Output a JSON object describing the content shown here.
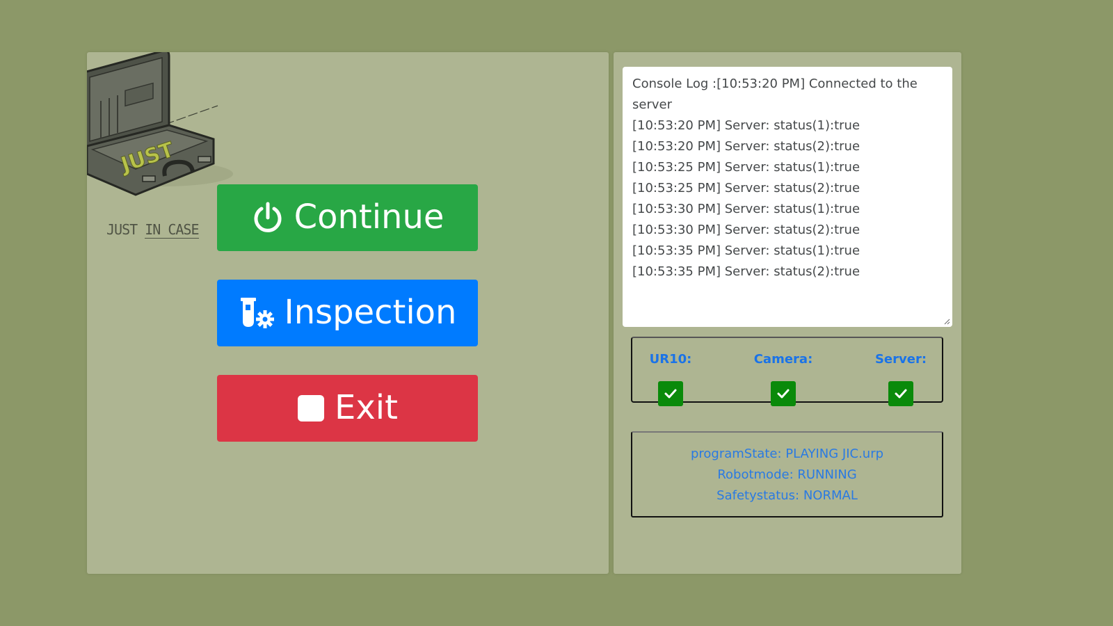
{
  "logo": {
    "caption_part1": "JUST ",
    "caption_part2": "IN CASE",
    "case_word": "JUST"
  },
  "buttons": {
    "continue": {
      "label": "Continue",
      "icon": "power-icon",
      "color": "#28a745"
    },
    "inspection": {
      "label": "Inspection",
      "icon": "flask-gear-icon",
      "color": "#007bff"
    },
    "exit": {
      "label": "Exit",
      "icon": "stop-icon",
      "color": "#dc3545"
    }
  },
  "console": {
    "lines": [
      "Console Log :[10:53:20 PM] Connected to the server",
      "[10:53:20 PM] Server: status(1):true",
      "[10:53:20 PM] Server: status(2):true",
      "[10:53:25 PM] Server: status(1):true",
      "[10:53:25 PM] Server: status(2):true",
      "[10:53:30 PM] Server: status(1):true",
      "[10:53:30 PM] Server: status(2):true",
      "[10:53:35 PM] Server: status(1):true",
      "[10:53:35 PM] Server: status(2):true"
    ]
  },
  "status": {
    "ur10": {
      "label": "UR10:",
      "ok": true
    },
    "camera": {
      "label": "Camera:",
      "ok": true
    },
    "server": {
      "label": "Server:",
      "ok": true
    }
  },
  "robot": {
    "program_state": "programState: PLAYING JIC.urp",
    "robot_mode": "Robotmode: RUNNING",
    "safety_status": "Safetystatus: NORMAL"
  }
}
